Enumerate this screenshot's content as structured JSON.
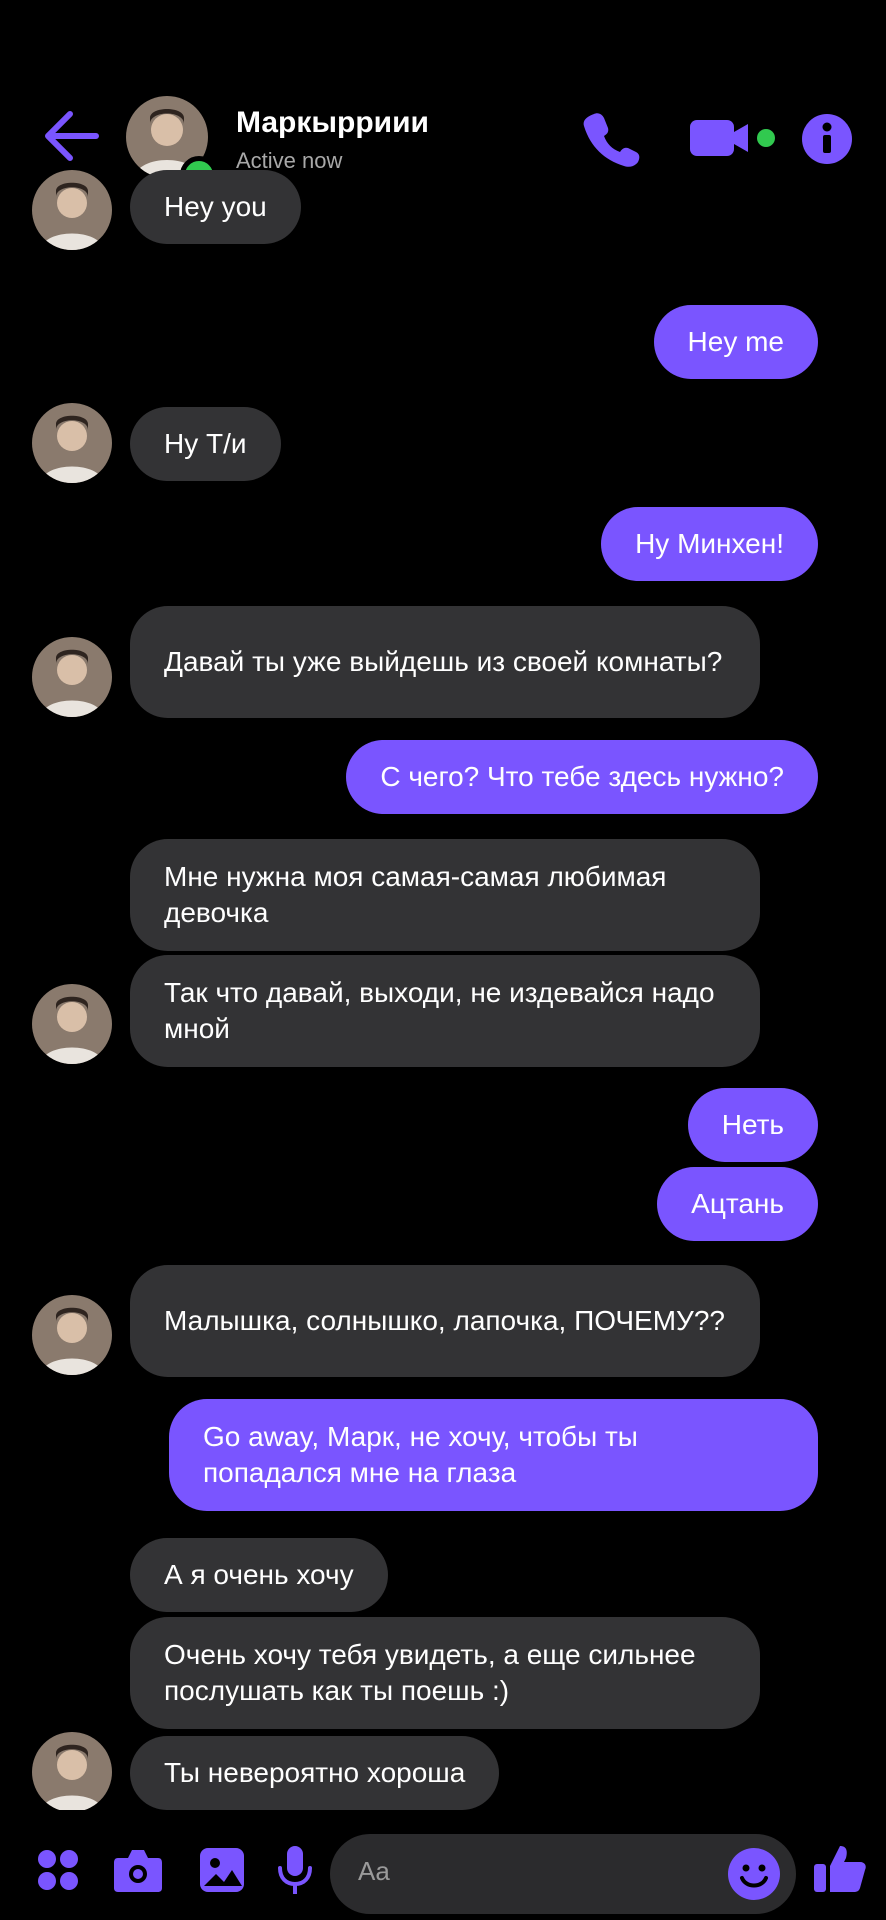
{
  "header": {
    "title": "Маркырриии",
    "status": "Active now",
    "accent": "#7a55ff",
    "online_color": "#31c94f"
  },
  "messages": [
    {
      "side": "in",
      "text": "Hey you"
    },
    {
      "side": "out",
      "text": "Hey me"
    },
    {
      "side": "in",
      "text": "Ну Т/и"
    },
    {
      "side": "out",
      "text": "Ну Минхен!"
    },
    {
      "side": "in",
      "text": "Давай ты уже выйдешь из своей комнаты?"
    },
    {
      "side": "out",
      "text": "С чего? Что тебе здесь нужно?"
    },
    {
      "side": "in",
      "text": "Мне нужна моя самая-самая любимая девочка"
    },
    {
      "side": "in",
      "text": "Так что давай, выходи, не издевайся надо мной"
    },
    {
      "side": "out",
      "text": "Неть"
    },
    {
      "side": "out",
      "text": "Ацтань"
    },
    {
      "side": "in",
      "text": "Малышка, солнышко, лапочка, ПОЧЕМУ??"
    },
    {
      "side": "out",
      "text": "Go away, Марк, не хочу, чтобы ты попадался мне на глаза"
    },
    {
      "side": "in",
      "text": "А я очень хочу"
    },
    {
      "side": "in",
      "text": "Очень хочу тебя увидеть, а еще сильнее послушать как ты поешь :)"
    },
    {
      "side": "in",
      "text": "Ты невероятно хороша"
    }
  ],
  "composer": {
    "placeholder": "Aa",
    "icons": [
      "apps-icon",
      "camera-icon",
      "gallery-icon",
      "microphone-icon",
      "emoji-icon",
      "like-icon"
    ]
  }
}
